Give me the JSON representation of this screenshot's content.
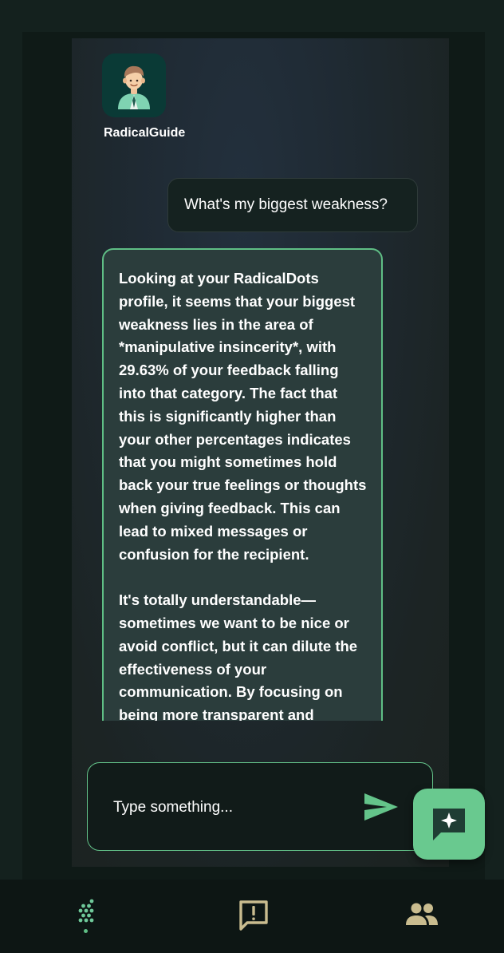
{
  "bot": {
    "name": "RadicalGuide",
    "avatar_icon": "guide-avatar-icon"
  },
  "messages": [
    {
      "role": "user",
      "text": "What's my biggest weakness?"
    },
    {
      "role": "assistant",
      "paragraphs": [
        "Looking at your RadicalDots profile, it seems that your biggest weakness lies in the area of *manipulative insincerity*, with 29.63% of your feedback falling into that category. The fact that this is significantly higher than your other percentages indicates that you might sometimes hold back your true feelings or thoughts when giving feedback. This can lead to mixed messages or confusion for the recipient.",
        "It's totally understandable—sometimes we want to be nice or avoid conflict, but it can dilute the effectiveness of your communication. By focusing on being more transparent and"
      ]
    }
  ],
  "composer": {
    "placeholder": "Type something...",
    "value": "",
    "send_icon": "send-icon"
  },
  "fab_icon": "chat-sparkle-icon",
  "nav": {
    "items": [
      {
        "icon": "dots-grid-icon",
        "active": true
      },
      {
        "icon": "feedback-icon",
        "active": false
      },
      {
        "icon": "people-icon",
        "active": false
      }
    ]
  },
  "colors": {
    "accent": "#64c48a",
    "fab": "#69c98f",
    "nav_icon": "#c9bc8f",
    "background": "#14211e"
  }
}
